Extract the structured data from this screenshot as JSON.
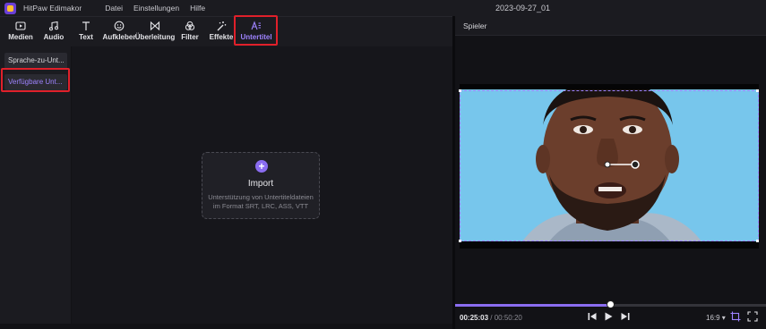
{
  "app": {
    "name": "HitPaw Edimakor",
    "project_title": "2023-09-27_01"
  },
  "menu": [
    "Datei",
    "Einstellungen",
    "Hilfe"
  ],
  "toolbar": {
    "tools": [
      {
        "label": "Medien",
        "icon": "media-icon"
      },
      {
        "label": "Audio",
        "icon": "music-note-icon"
      },
      {
        "label": "Text",
        "icon": "text-t-icon"
      },
      {
        "label": "Aufkleber",
        "icon": "sticker-smiley-icon"
      },
      {
        "label": "Überleitung",
        "icon": "transition-bowtie-icon"
      },
      {
        "label": "Filter",
        "icon": "filter-circles-icon"
      },
      {
        "label": "Effekte",
        "icon": "magic-wand-icon"
      },
      {
        "label": "Untertitel",
        "icon": "subtitle-ai-icon",
        "active": true
      }
    ]
  },
  "subtabs": [
    {
      "label": "Sprache-zu-Unt...",
      "active": false
    },
    {
      "label": "Verfügbare Unt...",
      "active": true
    }
  ],
  "import": {
    "title": "Import",
    "desc_line1": "Unterstützung von Untertiteldateien",
    "desc_line2": "im Format SRT, LRC, ASS, VTT"
  },
  "player": {
    "header": "Spieler",
    "current_time": "00:25:03",
    "separator": "/",
    "total_time": "00:50:20",
    "progress": 0.5,
    "aspect_ratio": "16:9 ▾"
  },
  "colors": {
    "accent": "#8a6cf0",
    "highlight": "#e0202a",
    "bg": "#121216",
    "panel": "#1b1b20"
  }
}
